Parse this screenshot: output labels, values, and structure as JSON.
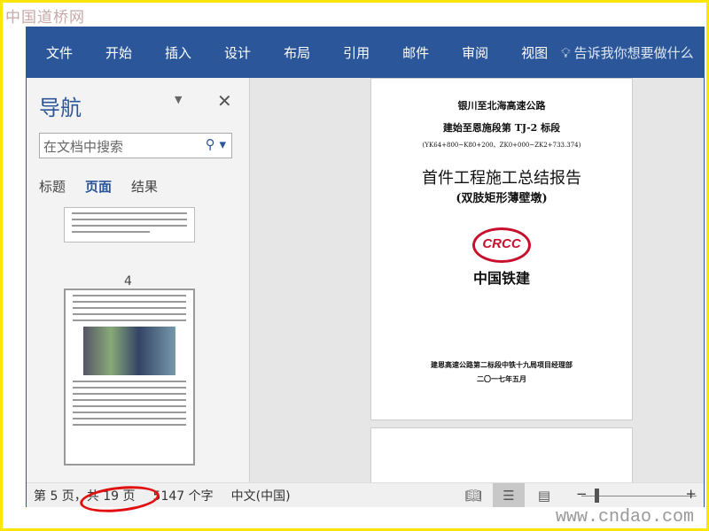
{
  "watermark_top": "中国道桥网",
  "watermark_bottom": "www.cndao.com",
  "ribbon": {
    "tabs": [
      "文件",
      "开始",
      "插入",
      "设计",
      "布局",
      "引用",
      "邮件",
      "审阅",
      "视图"
    ],
    "tell_me": "告诉我你想要做什么"
  },
  "nav": {
    "title": "导航",
    "search_placeholder": "在文档中搜索",
    "tabs": [
      "标题",
      "页面",
      "结果"
    ],
    "thumb_page_number": "4"
  },
  "page": {
    "line1": "银川至北海高速公路",
    "line2": "建始至恩施段第 TJ-2 标段",
    "line3": "(YK64+800~K80+200、ZK0+000~ZK2+733.374)",
    "title": "首件工程施工总结报告",
    "subtitle": "(双肢矩形薄壁墩)",
    "logo_text": "CRCC",
    "company": "中国铁建",
    "org": "建恩高速公路第二标段中铁十九局项目经理部",
    "date": "二〇一七年五月"
  },
  "status": {
    "page": "第 5 页，共 19 页",
    "words": "5147 个字",
    "lang": "中文(中国)"
  },
  "colors": {
    "accent": "#2b579a",
    "frame": "#ffe600",
    "annotation": "#e01010"
  }
}
